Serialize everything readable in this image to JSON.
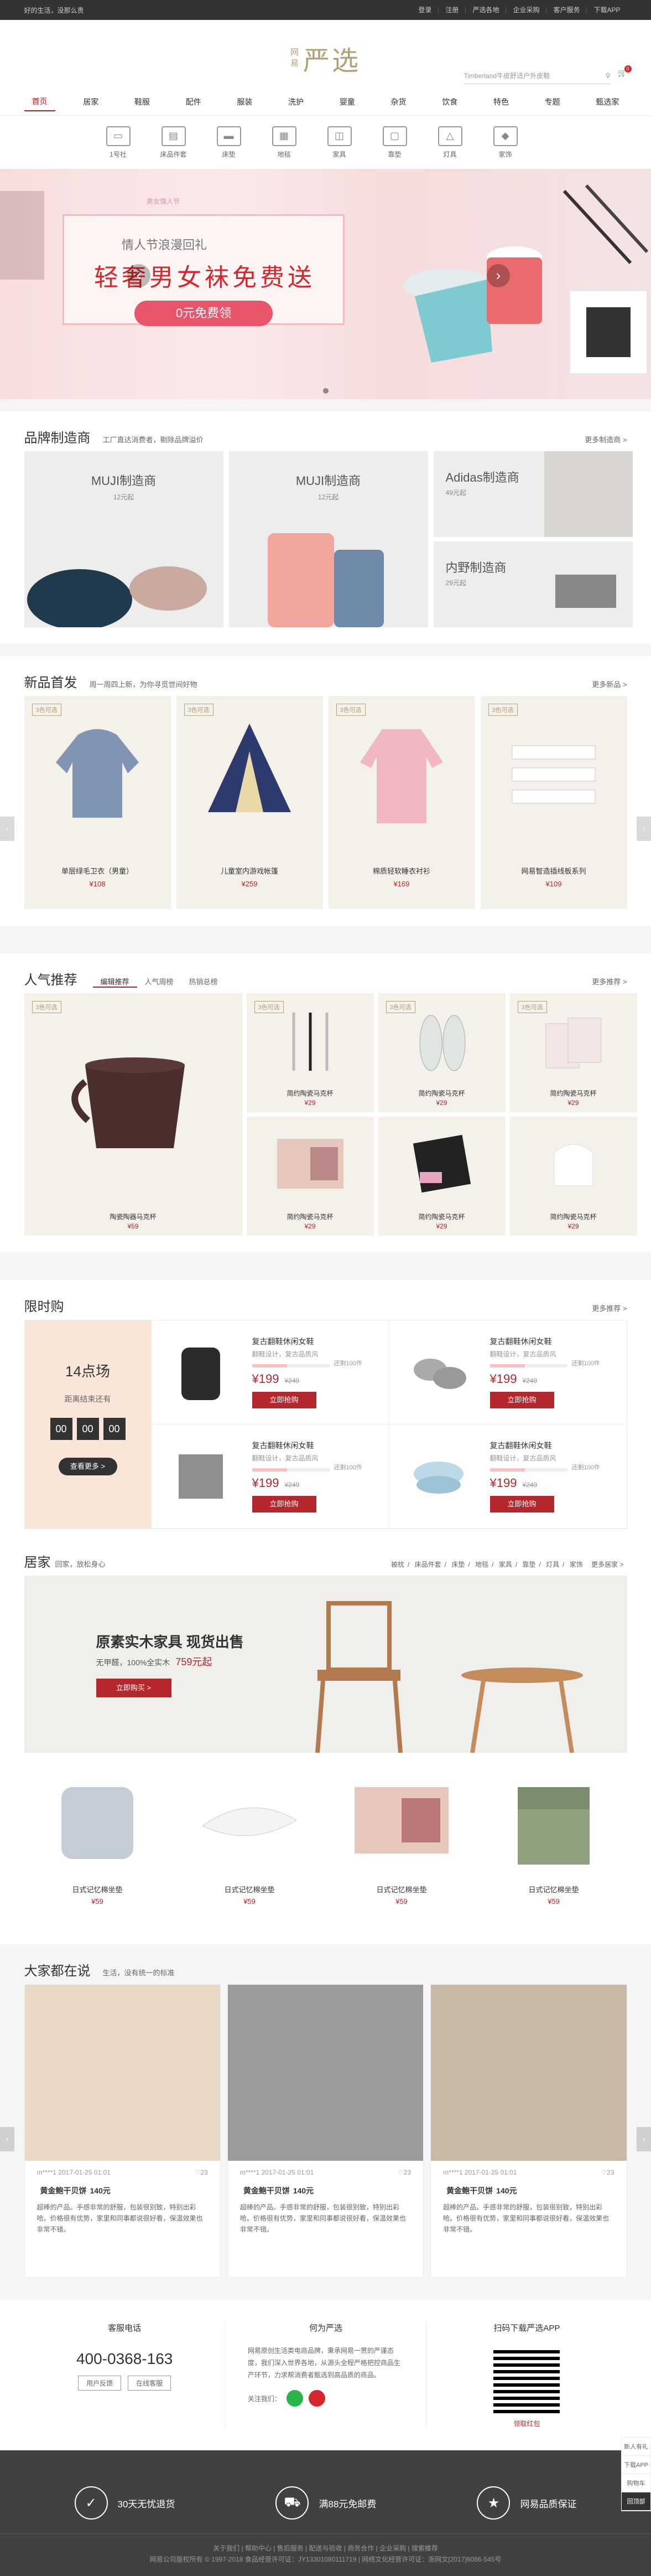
{
  "topbar": {
    "left": "好的生活，没那么贵",
    "links": [
      "登录",
      "注册",
      "严选各地",
      "企业采购",
      "客户服务",
      "下载APP"
    ]
  },
  "logo": {
    "line1": "网",
    "line2": "易",
    "big": "严选"
  },
  "search": {
    "placeholder": "Timberland牛皮舒适户外皮鞋"
  },
  "cart": {
    "count": "0"
  },
  "nav": [
    "首页",
    "居家",
    "鞋服",
    "配件",
    "服装",
    "洗护",
    "婴童",
    "杂货",
    "饮食",
    "特色",
    "专题",
    "甄选家"
  ],
  "subnav": [
    "1号社",
    "床品件套",
    "床垫",
    "地毯",
    "家具",
    "靠垫",
    "灯具",
    "家饰"
  ],
  "banner": {
    "line1": "情人节浪漫回礼",
    "line2": "轻奢男女袜免费送",
    "button": "0元免费领",
    "tag": "男女情人节"
  },
  "brand": {
    "title": "品牌制造商",
    "sub": "工厂直达消费者，剔除品牌溢价",
    "more": "更多制造商 >",
    "items": [
      {
        "name": "MUJI制造商",
        "price": "12元起"
      },
      {
        "name": "MUJI制造商",
        "price": "12元起"
      },
      {
        "name": "Adidas制造商",
        "price": "49元起"
      },
      {
        "name": "内野制造商",
        "price": "29元起"
      }
    ]
  },
  "newp": {
    "title": "新品首发",
    "sub": "周一周四上新，为你寻觅世间好物",
    "more": "更多新品 >",
    "items": [
      {
        "tag": "3色可选",
        "name": "单层绿毛卫衣（男童）",
        "price": "¥108"
      },
      {
        "tag": "3色可选",
        "name": "儿童室内游戏帐篷",
        "price": "¥259"
      },
      {
        "tag": "3色可选",
        "name": "棉质轻软睡衣衬衫",
        "price": "¥169"
      },
      {
        "tag": "3色可选",
        "name": "网易智造插线板系列",
        "price": "¥109"
      }
    ]
  },
  "pop": {
    "title": "人气推荐",
    "tabs": [
      "编辑推荐",
      "人气周榜",
      "热销总榜"
    ],
    "more": "更多推荐 >",
    "items": [
      {
        "tag": "3色可选",
        "name": "陶瓷陶器马克杯",
        "price": "¥59"
      },
      {
        "tag": "3色可选",
        "name": "简约陶瓷马克杯",
        "price": "¥29"
      },
      {
        "tag": "3色可选",
        "name": "简约陶瓷马克杯",
        "price": "¥29"
      },
      {
        "tag": "3色可选",
        "name": "简约陶瓷马克杯",
        "price": "¥29"
      },
      {
        "tag": "",
        "name": "简约陶瓷马克杯",
        "price": "¥29"
      },
      {
        "tag": "",
        "name": "简约陶瓷马克杯",
        "price": "¥29"
      },
      {
        "tag": "",
        "name": "简约陶瓷马克杯",
        "price": "¥29"
      }
    ]
  },
  "flash": {
    "title": "限时购",
    "more": "更多推荐 >",
    "session": "14点场",
    "desc": "距离结束还有",
    "h": "00",
    "m": "00",
    "s": "00",
    "go": "查看更多 >",
    "items": [
      {
        "name": "复古翻鞋休闲女鞋",
        "sub": "翻鞋设计，复古品质风",
        "sold": "还剩100件",
        "progress": 0.45,
        "price": "¥199",
        "old": "¥249",
        "buy": "立即抢购"
      },
      {
        "name": "复古翻鞋休闲女鞋",
        "sub": "翻鞋设计，复古品质风",
        "sold": "还剩100件",
        "progress": 0.45,
        "price": "¥199",
        "old": "¥249",
        "buy": "立即抢购"
      },
      {
        "name": "复古翻鞋休闲女鞋",
        "sub": "翻鞋设计，复古品质风",
        "sold": "还剩100件",
        "progress": 0.45,
        "price": "¥199",
        "old": "¥249",
        "buy": "立即抢购"
      },
      {
        "name": "复古翻鞋休闲女鞋",
        "sub": "翻鞋设计，复古品质风",
        "sold": "还剩100件",
        "progress": 0.45,
        "price": "¥199",
        "old": "¥249",
        "buy": "立即抢购"
      }
    ]
  },
  "home": {
    "title": "居家",
    "sub": "回家，放松身心",
    "cats": [
      "被枕",
      "床品件套",
      "床垫",
      "地毯",
      "家具",
      "靠垫",
      "灯具",
      "家饰"
    ],
    "more": "更多居家 >",
    "banner": {
      "title": "原素实木家具  现货出售",
      "sub": "无甲醛，100%全实木",
      "price": "759元起",
      "btn": "立即购买 >"
    },
    "items": [
      {
        "name": "日式记忆棉坐垫",
        "price": "¥59"
      },
      {
        "name": "日式记忆棉坐垫",
        "price": "¥59"
      },
      {
        "name": "日式记忆棉坐垫",
        "price": "¥59"
      },
      {
        "name": "日式记忆棉坐垫",
        "price": "¥59"
      }
    ]
  },
  "reviews": {
    "title": "大家都在说",
    "sub": "生活，没有统一的标准",
    "items": [
      {
        "user": "m****1",
        "date": "2017-01-25 01:01",
        "likes": "♡23",
        "name": "黄金鲍干贝饼",
        "price": "140元",
        "text": "超棒的产品。手感非常的舒服，包装很别致，特别出彩哈。价格很有优势，家里和同事都说很好看，保温效果也非常不错。"
      },
      {
        "user": "m****1",
        "date": "2017-01-25 01:01",
        "likes": "♡23",
        "name": "黄金鲍干贝饼",
        "price": "140元",
        "text": "超棒的产品。手感非常的舒服，包装很别致，特别出彩哈。价格很有优势，家里和同事都说很好看，保温效果也非常不错。"
      },
      {
        "user": "m****1",
        "date": "2017-01-25 01:01",
        "likes": "♡23",
        "name": "黄金鲍干贝饼",
        "price": "140元",
        "text": "超棒的产品。手感非常的舒服，包装很别致，特别出彩哈。价格很有优势，家里和同事都说很好看，保温效果也非常不错。"
      }
    ]
  },
  "service": {
    "col1": {
      "title": "客服电话",
      "tel": "400-0368-163",
      "b1": "用户反馈",
      "b2": "在线客服"
    },
    "col2": {
      "title": "何为严选",
      "text": "网易原创生活类电商品牌，秉承网易一贯的严谨态度，我们深入世界各地，从源头全程严格把控商品生产环节，力求帮消费者甄选到高品质的商品。",
      "follow": "关注我们："
    },
    "col3": {
      "title": "扫码下载严选APP",
      "qr": "领取红包"
    }
  },
  "bottom": {
    "items": [
      "30天无忧退货",
      "满88元免邮费",
      "网易品质保证"
    ],
    "copy1": "关于我们 | 帮助中心 | 售后服务 | 配送与验收 | 商务合作 | 企业采购 | 搜索推荐",
    "copy2": "网易公司版权所有 © 1997-2018  食品经营许可证：JY13301080111719  | 网络文化经营许可证：浙网文[2017]6086-545号"
  },
  "float": [
    "新人有礼",
    "下载APP",
    "购物车",
    "回顶部"
  ],
  "colors": {
    "accent": "#b4282d",
    "gold": "#b4a078"
  }
}
